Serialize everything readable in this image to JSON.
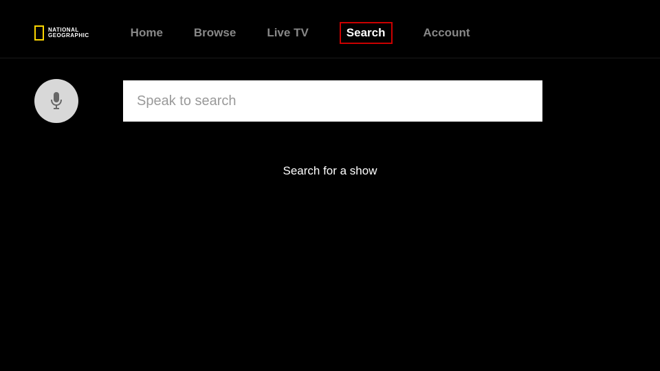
{
  "brand": {
    "line1": "NATIONAL",
    "line2": "GEOGRAPHIC"
  },
  "nav": {
    "items": [
      {
        "label": "Home",
        "active": false
      },
      {
        "label": "Browse",
        "active": false
      },
      {
        "label": "Live TV",
        "active": false
      },
      {
        "label": "Search",
        "active": true
      },
      {
        "label": "Account",
        "active": false
      }
    ]
  },
  "search": {
    "placeholder": "Speak to search",
    "prompt": "Search for a show"
  }
}
